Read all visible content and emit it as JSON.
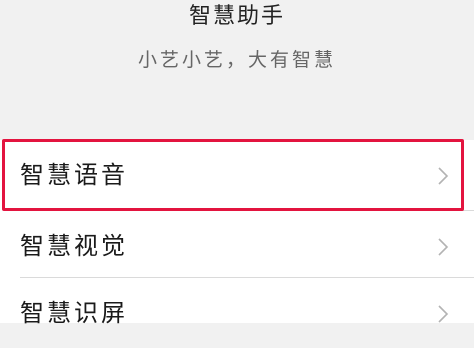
{
  "header": {
    "title": "智慧助手",
    "subtitle": "小艺小艺，大有智慧"
  },
  "menu": {
    "items": [
      {
        "label": "智慧语音",
        "icon": "chevron-right-icon",
        "highlighted": true
      },
      {
        "label": "智慧视觉",
        "icon": "chevron-right-icon",
        "highlighted": false
      },
      {
        "label": "智慧识屏",
        "icon": "chevron-right-icon",
        "highlighted": false
      }
    ]
  },
  "colors": {
    "highlight": "#e3143f",
    "background": "#f1f1f1",
    "list_background": "#ffffff",
    "chevron": "#b3b3b3"
  }
}
